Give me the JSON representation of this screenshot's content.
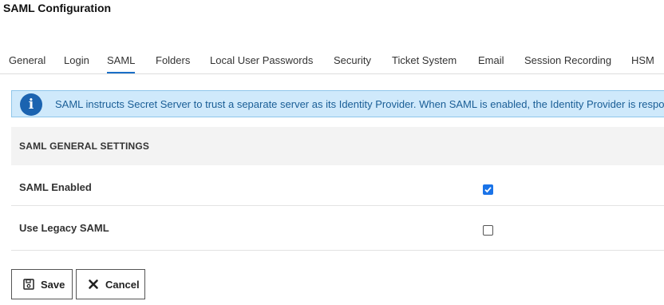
{
  "page": {
    "title": "SAML Configuration"
  },
  "tabs": [
    {
      "label": "General",
      "active": false
    },
    {
      "label": "Login",
      "active": false
    },
    {
      "label": "SAML",
      "active": true
    },
    {
      "label": "Folders",
      "active": false
    },
    {
      "label": "Local User Passwords",
      "active": false
    },
    {
      "label": "Security",
      "active": false
    },
    {
      "label": "Ticket System",
      "active": false
    },
    {
      "label": "Email",
      "active": false
    },
    {
      "label": "Session Recording",
      "active": false
    },
    {
      "label": "HSM",
      "active": false
    }
  ],
  "info": {
    "icon": "info-icon",
    "text": "SAML instructs Secret Server to trust a separate server as its Identity Provider. When SAML is enabled, the Identity Provider is respo"
  },
  "section": {
    "title": "SAML GENERAL SETTINGS"
  },
  "settings": [
    {
      "label": "SAML Enabled",
      "checked": true
    },
    {
      "label": "Use Legacy SAML",
      "checked": false
    }
  ],
  "buttons": {
    "save": {
      "label": "Save",
      "icon": "floppy-disk-icon"
    },
    "cancel": {
      "label": "Cancel",
      "icon": "close-icon"
    }
  },
  "colors": {
    "accent": "#1a73e8",
    "info_background": "#cfe9fb",
    "info_text": "#1a5e96"
  }
}
